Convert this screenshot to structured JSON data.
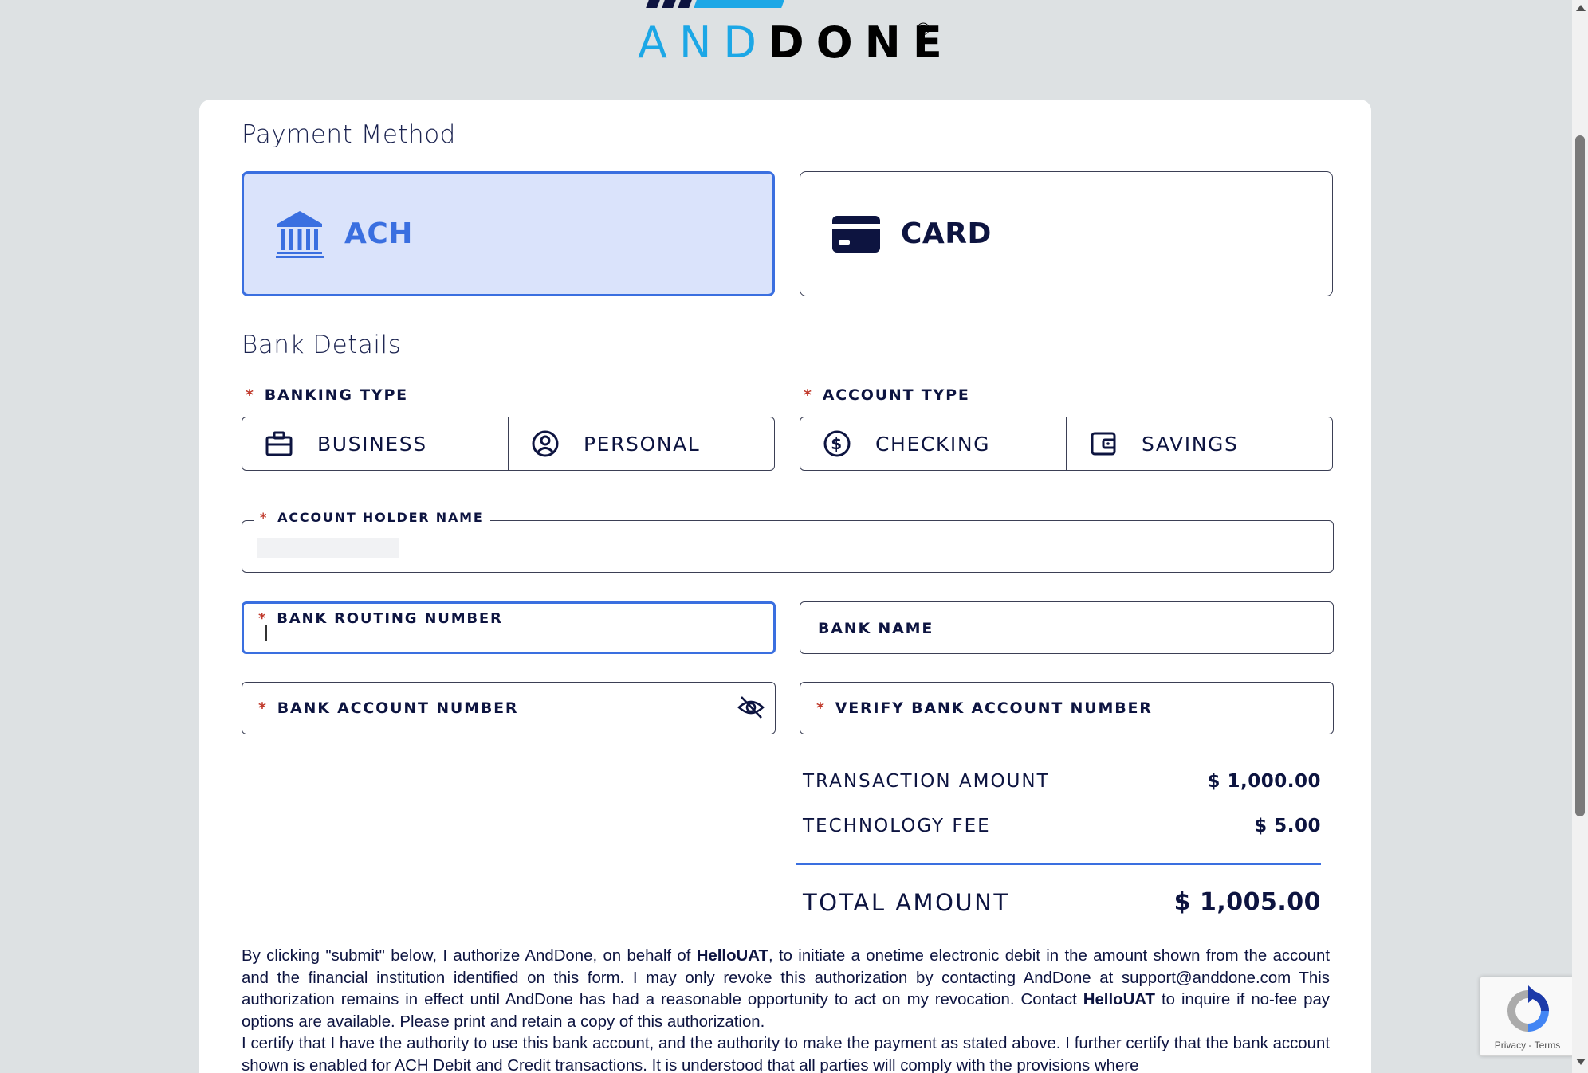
{
  "brand": {
    "logo_and": "AND",
    "logo_done": "DONE",
    "logo_mark": "®"
  },
  "colors": {
    "accent": "#3a6fe0",
    "selected_bg": "#dae3fb",
    "navy": "#0d1440",
    "required": "#c0392b",
    "logo_blue": "#1ca7e6",
    "page_bg": "#dde1e3"
  },
  "payment_method": {
    "title": "Payment Method",
    "options": [
      {
        "label": "ACH",
        "icon": "bank-icon",
        "selected": true
      },
      {
        "label": "CARD",
        "icon": "credit-card-icon",
        "selected": false
      }
    ]
  },
  "bank_details": {
    "title": "Bank Details",
    "banking_type": {
      "label": "BANKING TYPE",
      "required_mark": "*",
      "options": [
        {
          "label": "BUSINESS",
          "icon": "briefcase-icon"
        },
        {
          "label": "PERSONAL",
          "icon": "user-circle-icon"
        }
      ]
    },
    "account_type": {
      "label": "ACCOUNT TYPE",
      "required_mark": "*",
      "options": [
        {
          "label": "CHECKING",
          "icon": "dollar-circle-icon"
        },
        {
          "label": "SAVINGS",
          "icon": "wallet-icon"
        }
      ]
    },
    "account_holder_name": {
      "label": "ACCOUNT HOLDER NAME",
      "required_mark": "*",
      "value": ""
    },
    "routing_number": {
      "label": "BANK ROUTING NUMBER",
      "required_mark": "*",
      "value": ""
    },
    "bank_name": {
      "label": "BANK NAME",
      "value": ""
    },
    "account_number": {
      "label": "BANK ACCOUNT NUMBER",
      "required_mark": "*",
      "value": "",
      "toggle_icon": "eye-off-icon"
    },
    "verify_account_number": {
      "label": "VERIFY BANK ACCOUNT NUMBER",
      "required_mark": "*",
      "value": ""
    }
  },
  "summary": {
    "transaction_amount": {
      "label": "TRANSACTION AMOUNT",
      "value": "$ 1,000.00"
    },
    "technology_fee": {
      "label": "TECHNOLOGY FEE",
      "value": "$ 5.00"
    },
    "total_amount": {
      "label": "TOTAL AMOUNT",
      "value": "$ 1,005.00"
    }
  },
  "legal": {
    "p1_a": "By clicking \"submit\" below, I authorize AndDone, on behalf of ",
    "merchant": "HelloUAT",
    "p1_b": ", to initiate a onetime electronic debit in the amount shown from the account and the financial institution identified on this form. I may only revoke this authorization by contacting AndDone at support@anddone.com This authorization remains in effect until AndDone has had a reasonable opportunity to act on my revocation. Contact ",
    "p1_c": " to inquire if no-fee pay options are available. Please print and retain a copy of this authorization.",
    "p2": "I certify that I have the authority to use this bank account, and the authority to make the payment as stated above. I further certify that the bank account shown is enabled for ACH Debit and Credit transactions. It is understood that all parties will comply with the provisions where"
  },
  "recaptcha": {
    "privacy": "Privacy",
    "separator": " - ",
    "terms": "Terms"
  }
}
